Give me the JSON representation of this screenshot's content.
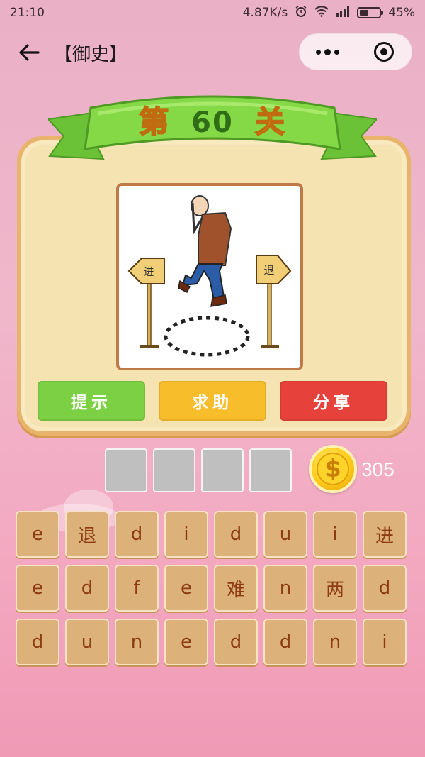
{
  "status_bar": {
    "time": "21:10",
    "speed": "4.87K/s",
    "battery": "45%",
    "battery_level": 0.45
  },
  "nav": {
    "title": "【御史】"
  },
  "level": {
    "prefix": "第",
    "number": "60",
    "suffix": "关"
  },
  "picture": {
    "left_sign": "进",
    "right_sign": "退"
  },
  "actions": {
    "hint": "提示",
    "help": "求助",
    "share": "分享"
  },
  "answer_slots": 4,
  "coins": {
    "count": "305",
    "symbol": "$"
  },
  "letters": [
    [
      "e",
      "退",
      "d",
      "i",
      "d",
      "u",
      "i",
      "进"
    ],
    [
      "e",
      "d",
      "f",
      "e",
      "难",
      "n",
      "两",
      "d"
    ],
    [
      "d",
      "u",
      "n",
      "e",
      "d",
      "d",
      "n",
      "i"
    ]
  ],
  "colors": {
    "hint": "#7cd043",
    "help": "#f8bd2b",
    "share": "#e6423b",
    "key": "#dcb17a",
    "ribbon": "#7cce3c"
  }
}
